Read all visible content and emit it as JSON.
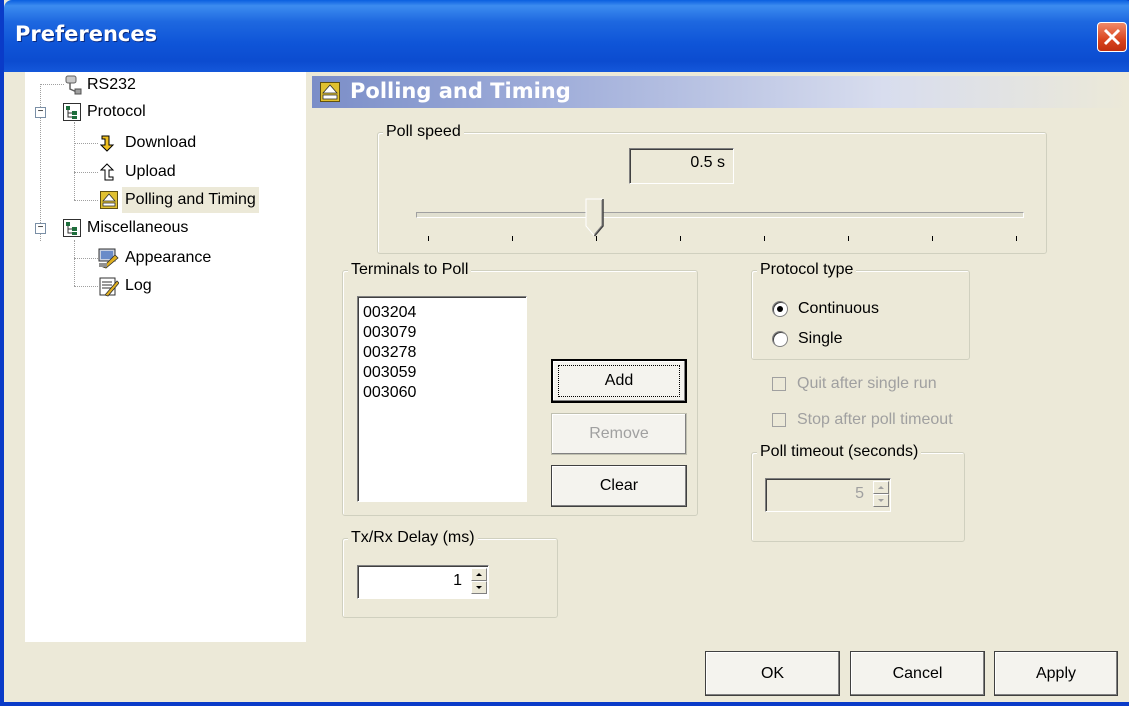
{
  "window": {
    "title": "Preferences"
  },
  "tree": {
    "items": [
      {
        "label": "RS232",
        "icon": "serial-port-icon"
      },
      {
        "label": "Protocol",
        "icon": "tree-folder-icon",
        "expanded": true
      },
      {
        "label": "Download",
        "icon": "download-arrow-icon"
      },
      {
        "label": "Upload",
        "icon": "upload-arrow-icon"
      },
      {
        "label": "Polling and Timing",
        "icon": "eject-icon",
        "selected": true
      },
      {
        "label": "Miscellaneous",
        "icon": "tree-folder-icon",
        "expanded": true
      },
      {
        "label": "Appearance",
        "icon": "appearance-icon"
      },
      {
        "label": "Log",
        "icon": "log-icon"
      }
    ]
  },
  "panel": {
    "title": "Polling and Timing"
  },
  "poll_speed": {
    "label": "Poll speed",
    "value": "0.5 s",
    "slider_position": 0.29,
    "tick_count": 8
  },
  "terminals": {
    "label": "Terminals to Poll",
    "items": [
      "003204",
      "003079",
      "003278",
      "003059",
      "003060"
    ],
    "add_label": "Add",
    "remove_label": "Remove",
    "clear_label": "Clear"
  },
  "protocol_type": {
    "label": "Protocol type",
    "options": [
      "Continuous",
      "Single"
    ],
    "selected": "Continuous"
  },
  "options": {
    "quit_after_single_run": "Quit after single run",
    "stop_after_poll_timeout": "Stop after poll timeout"
  },
  "poll_timeout": {
    "label": "Poll timeout (seconds)",
    "value": "5"
  },
  "txrx_delay": {
    "label": "Tx/Rx Delay (ms)",
    "value": "1"
  },
  "footer": {
    "ok_label": "OK",
    "cancel_label": "Cancel",
    "apply_label": "Apply"
  },
  "colors": {
    "titlebar": "#0C4CD0",
    "dialog_bg": "#ECE9D8",
    "close_button": "#D9441E"
  }
}
